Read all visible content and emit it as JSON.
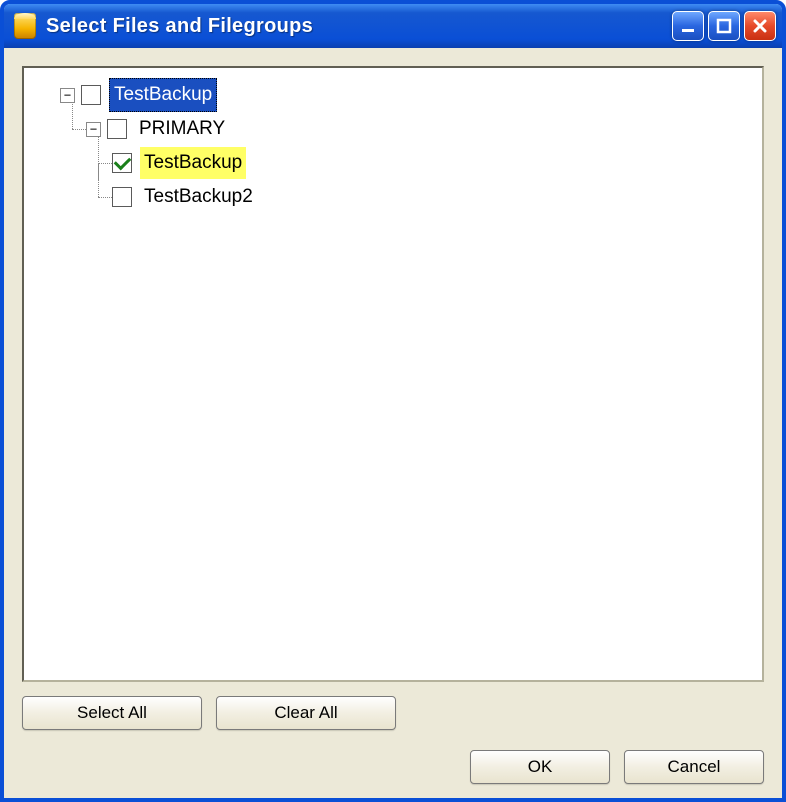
{
  "window": {
    "title": "Select Files and Filegroups"
  },
  "tree": {
    "root": {
      "label": "TestBackup",
      "expanded": true,
      "checked": false,
      "selected": true,
      "highlighted": false,
      "children": [
        {
          "label": "PRIMARY",
          "expanded": true,
          "checked": false,
          "selected": false,
          "highlighted": false,
          "children": [
            {
              "label": "TestBackup",
              "checked": true,
              "selected": false,
              "highlighted": true
            },
            {
              "label": "TestBackup2",
              "checked": false,
              "selected": false,
              "highlighted": false
            }
          ]
        }
      ]
    }
  },
  "buttons": {
    "select_all": "Select All",
    "clear_all": "Clear All",
    "ok": "OK",
    "cancel": "Cancel"
  },
  "expander_glyph": {
    "expanded": "−",
    "collapsed": "+"
  }
}
